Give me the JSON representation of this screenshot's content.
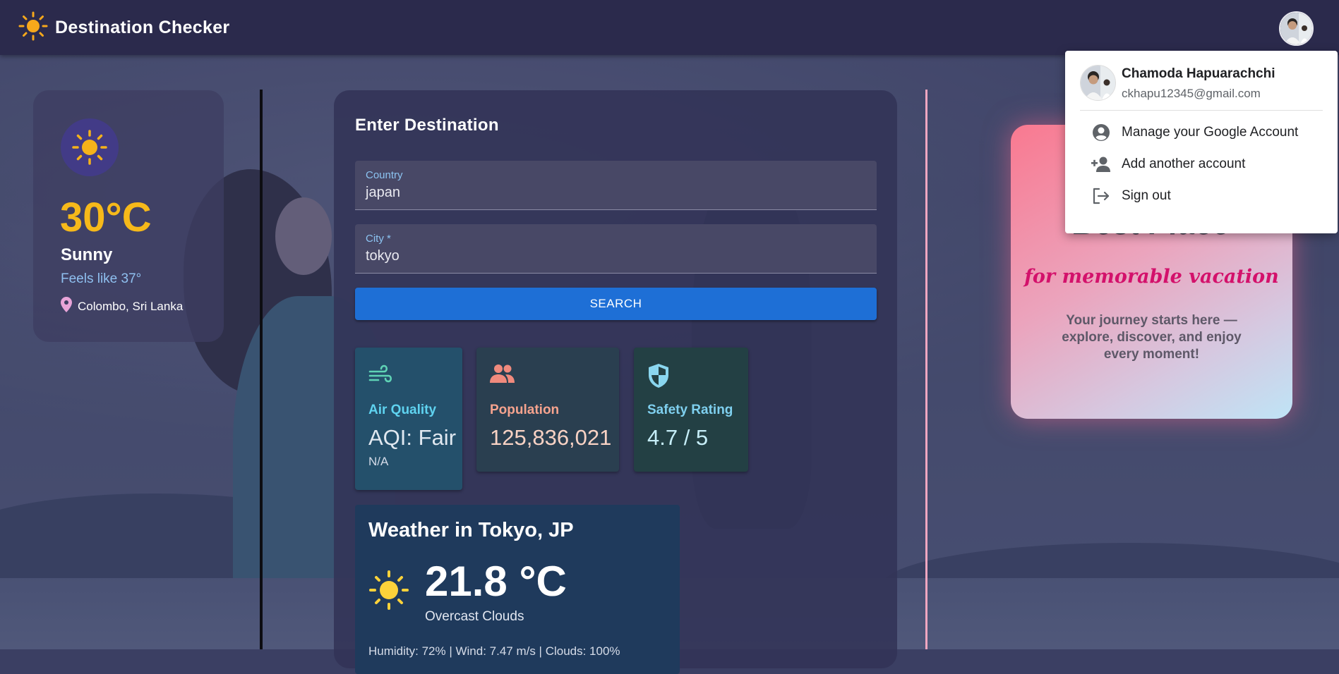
{
  "app": {
    "title": "Destination Checker",
    "accent": "#1e6fd6"
  },
  "current_weather": {
    "temperature": "30°C",
    "condition": "Sunny",
    "feels_like": "Feels like 37°",
    "location": "Colombo, Sri Lanka",
    "icon": "sun-icon"
  },
  "search_form": {
    "title": "Enter Destination",
    "country_label": "Country",
    "country_value": "japan",
    "city_label": "City *",
    "city_value": "tokyo",
    "search_label": "SEARCH"
  },
  "stats": {
    "air_quality": {
      "label": "Air Quality",
      "value": "AQI: Fair",
      "sub": "N/A",
      "icon": "wind-icon",
      "color": "#5fd3b5"
    },
    "population": {
      "label": "Population",
      "value": "125,836,021",
      "icon": "people-icon",
      "color": "#f08a7d"
    },
    "safety": {
      "label": "Safety Rating",
      "value": "4.7 / 5",
      "icon": "shield-icon",
      "color": "#7fd0ef"
    }
  },
  "destination_weather": {
    "title": "Weather in Tokyo, JP",
    "temperature": "21.8 °C",
    "description": "Overcast Clouds",
    "details": "Humidity: 72% | Wind: 7.47 m/s | Clouds: 100%"
  },
  "promo": {
    "title": "Best Place",
    "subtitle": "for memorable vacation",
    "text": "Your journey starts here — explore, discover, and enjoy every moment!"
  },
  "account_menu": {
    "name": "Chamoda Hapuarachchi",
    "email": "ckhapu12345@gmail.com",
    "items": [
      {
        "label": "Manage your Google Account",
        "icon": "account-circle-icon"
      },
      {
        "label": "Add another account",
        "icon": "person-add-icon"
      },
      {
        "label": "Sign out",
        "icon": "sign-out-icon"
      }
    ]
  }
}
